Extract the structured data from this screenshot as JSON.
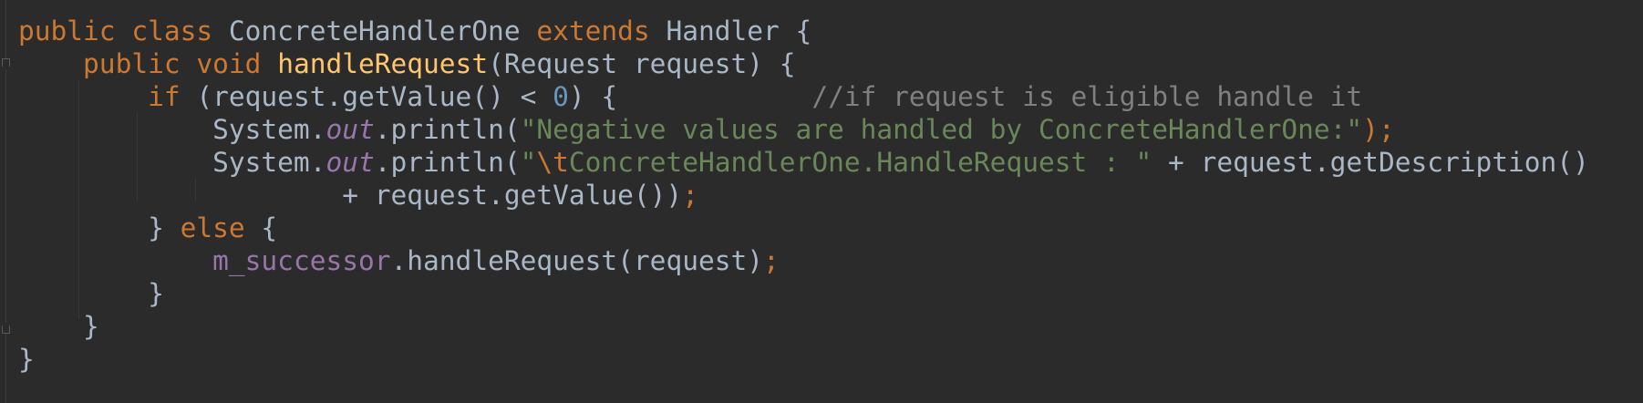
{
  "editor": {
    "theme": "darcula",
    "colors": {
      "background": "#2b2b2b",
      "text": "#a9b7c6",
      "keyword": "#cc7832",
      "method_decl": "#ffc66d",
      "number": "#6897bb",
      "string": "#6a8759",
      "comment": "#808080",
      "field": "#9876aa"
    },
    "lines": [
      {
        "tokens": [
          {
            "t": "public class ",
            "c": "kw"
          },
          {
            "t": "ConcreteHandlerOne ",
            "c": "txt"
          },
          {
            "t": "extends ",
            "c": "kw"
          },
          {
            "t": "Handler {",
            "c": "txt"
          }
        ]
      },
      {
        "tokens": [
          {
            "t": "    ",
            "c": "txt"
          },
          {
            "t": "public void ",
            "c": "kw"
          },
          {
            "t": "handleRequest",
            "c": "fn"
          },
          {
            "t": "(Request request) {",
            "c": "txt"
          }
        ]
      },
      {
        "tokens": [
          {
            "t": "        ",
            "c": "txt"
          },
          {
            "t": "if ",
            "c": "kw"
          },
          {
            "t": "(request.getValue() < ",
            "c": "txt"
          },
          {
            "t": "0",
            "c": "num"
          },
          {
            "t": ") {            ",
            "c": "txt"
          },
          {
            "t": "//if request is eligible handle it",
            "c": "cmt"
          }
        ]
      },
      {
        "tokens": [
          {
            "t": "            System.",
            "c": "txt"
          },
          {
            "t": "out",
            "c": "static"
          },
          {
            "t": ".println(",
            "c": "txt"
          },
          {
            "t": "\"Negative values are handled by ConcreteHandlerOne:\"",
            "c": "str"
          },
          {
            "t": ");",
            "c": "punc"
          }
        ]
      },
      {
        "tokens": [
          {
            "t": "            System.",
            "c": "txt"
          },
          {
            "t": "out",
            "c": "static"
          },
          {
            "t": ".println(",
            "c": "txt"
          },
          {
            "t": "\"",
            "c": "str"
          },
          {
            "t": "\\t",
            "c": "esc"
          },
          {
            "t": "ConcreteHandlerOne.HandleRequest : \"",
            "c": "str"
          },
          {
            "t": " + request.getDescription()",
            "c": "txt"
          }
        ]
      },
      {
        "tokens": [
          {
            "t": "                    + request.getValue())",
            "c": "txt"
          },
          {
            "t": ";",
            "c": "punc"
          }
        ]
      },
      {
        "tokens": [
          {
            "t": "        } ",
            "c": "txt"
          },
          {
            "t": "else ",
            "c": "kw"
          },
          {
            "t": "{",
            "c": "txt"
          }
        ]
      },
      {
        "tokens": [
          {
            "t": "            ",
            "c": "txt"
          },
          {
            "t": "m_successor",
            "c": "field"
          },
          {
            "t": ".handleRequest(request)",
            "c": "txt"
          },
          {
            "t": ";",
            "c": "punc"
          }
        ]
      },
      {
        "tokens": [
          {
            "t": "        }",
            "c": "txt"
          }
        ]
      },
      {
        "tokens": [
          {
            "t": "    }",
            "c": "txt"
          }
        ]
      },
      {
        "tokens": [
          {
            "t": "}",
            "c": "txt"
          }
        ]
      }
    ]
  }
}
